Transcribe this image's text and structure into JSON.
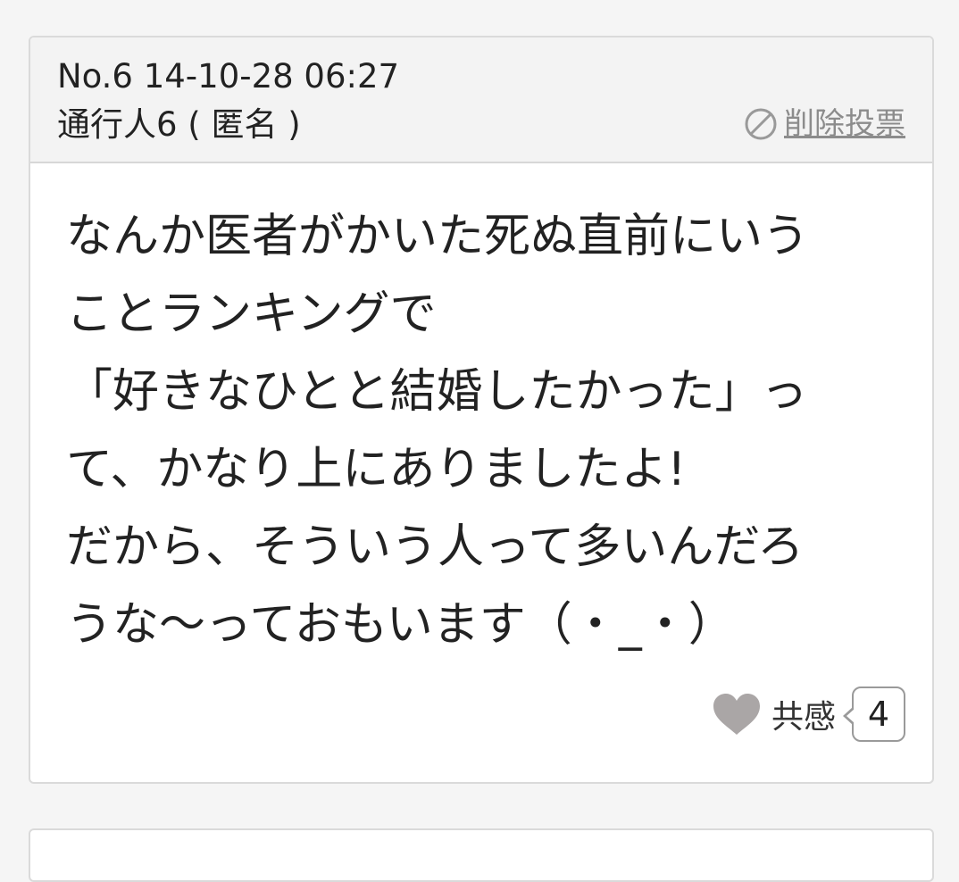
{
  "post": {
    "meta": "No.6 14-10-28 06:27",
    "author": "通行人6 ( 匿名 )",
    "delete_vote": {
      "icon": "prohibited-icon",
      "label": "削除投票"
    },
    "body_lines": [
      "なんか医者がかいた死ぬ直前にいう",
      "ことランキングで",
      "「好きなひとと結婚したかった」っ",
      "て、かなり上にありましたよ!",
      "だから、そういう人って多いんだろ",
      "うな〜っておもいます（・_・）"
    ],
    "empathy": {
      "icon": "heart-icon",
      "label": "共感",
      "count": "4"
    }
  },
  "colors": {
    "page_background": "#f5f5f5",
    "card_background": "#ffffff",
    "header_background": "#f3f3f3",
    "border": "#dadada",
    "muted_text": "#8c8c8c",
    "heart": "#aaa6a6"
  }
}
